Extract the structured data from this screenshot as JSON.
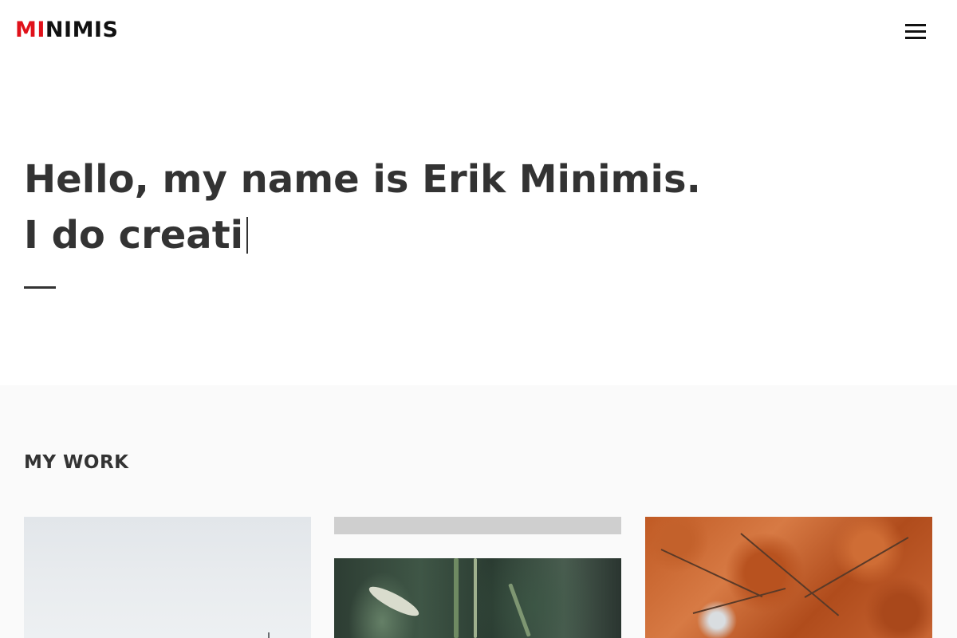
{
  "header": {
    "logo_accent": "MI",
    "logo_rest": "NIMIS",
    "menu_icon": "hamburger-menu-icon"
  },
  "hero": {
    "line1": "Hello, my name is Erik Minimis.",
    "line2_typed": "I do creati"
  },
  "work": {
    "heading": "MY WORK",
    "items": [
      {
        "image": "misty-field-photo"
      },
      {
        "image": "grass-closeup-photo"
      },
      {
        "image": "autumn-tree-photo"
      }
    ]
  },
  "colors": {
    "accent": "#e0111a",
    "text": "#333333",
    "section_bg": "#fafafa"
  }
}
